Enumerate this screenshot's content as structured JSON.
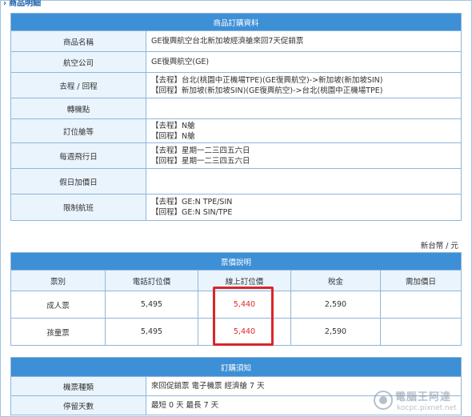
{
  "section": {
    "title": "商品明細"
  },
  "product": {
    "header": "商品訂購資料",
    "rows": [
      {
        "label": "商品名稱",
        "lines": [
          "GE復興航空台北新加坡經濟艙來回7天促銷票"
        ]
      },
      {
        "label": "航空公司",
        "lines": [
          "GE復興航空(GE)"
        ]
      },
      {
        "label": "去程 / 回程",
        "lines": [
          "【去程】台北(桃園中正機場TPE)(GE復興航空)->新加坡(新加坡SIN)",
          "【回程】新加坡(新加坡SIN)(GE復興航空)->台北(桃園中正機場TPE)"
        ]
      },
      {
        "label": "轉機點",
        "lines": []
      },
      {
        "label": "訂位艙等",
        "lines": [
          "【去程】N艙",
          "【回程】N艙"
        ]
      },
      {
        "label": "每週飛行日",
        "lines": [
          "【去程】星期一二三四五六日",
          "【回程】星期一二三四五六日"
        ]
      },
      {
        "label": "假日加價日",
        "lines": []
      },
      {
        "label": "限制航班",
        "lines": [
          "【去程】GE:N TPE/SIN",
          "【回程】GE:N SIN/TPE"
        ]
      }
    ]
  },
  "currency_note": "新台幣 / 元",
  "price": {
    "header": "票價說明",
    "columns": [
      "票別",
      "電話訂位價",
      "線上訂位價",
      "稅金",
      "需加價日"
    ],
    "rows": [
      {
        "type": "成人票",
        "phone": "5,495",
        "online": "5,440",
        "tax": "2,590",
        "extra": ""
      },
      {
        "type": "孩童票",
        "phone": "5,495",
        "online": "5,440",
        "tax": "2,590",
        "extra": ""
      }
    ],
    "online_color": "#e3262a"
  },
  "notice": {
    "header": "訂購須知",
    "rows": [
      {
        "label": "機票種類",
        "value": "來回促銷票 電子機票 經濟艙 7 天"
      },
      {
        "label": "停留天數",
        "value": "最短 0 天 最長 7 天"
      }
    ]
  },
  "watermark": {
    "line1": "電腦王阿達",
    "line2": "kocpc.pixnet.net"
  },
  "colors": {
    "header_bg": "#3d8fd6",
    "label_bg": "#eaf4fd",
    "border": "#8fb6dc",
    "highlight": "#d9262a"
  }
}
